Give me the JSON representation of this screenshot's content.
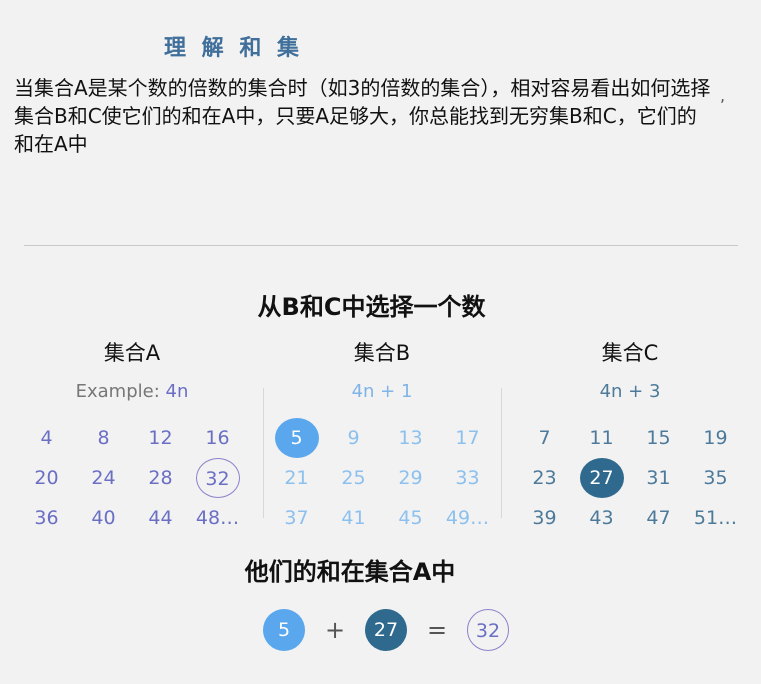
{
  "title": "理 解 和 集",
  "intro": "当集合A是某个数的倍数的集合时（如3的倍数的集合），相对容易看出如何选择集合B和C使它们的和在A中，只要A足够大，你总能找到无穷集B和C，它们的和在A中",
  "stray_mark": ",",
  "choose_heading": "从B和C中选择一个数",
  "sets": {
    "a": {
      "name": "集合A",
      "example_label": "Example:",
      "formula": "4n",
      "numbers": [
        "4",
        "8",
        "12",
        "16",
        "20",
        "24",
        "28",
        "32",
        "36",
        "40",
        "44",
        "48…"
      ]
    },
    "b": {
      "name": "集合B",
      "formula": "4n + 1",
      "numbers": [
        "5",
        "9",
        "13",
        "17",
        "21",
        "25",
        "29",
        "33",
        "37",
        "41",
        "45",
        "49…"
      ]
    },
    "c": {
      "name": "集合C",
      "formula": "4n + 3",
      "numbers": [
        "7",
        "11",
        "15",
        "19",
        "23",
        "27",
        "31",
        "35",
        "39",
        "43",
        "47",
        "51…"
      ]
    }
  },
  "sum_heading": "他们的和在集合A中",
  "equation": {
    "b": "5",
    "plus": "+",
    "c": "27",
    "equals": "=",
    "a": "32"
  },
  "colors": {
    "title": "#3f6f9a",
    "set_a": "#6a6fc4",
    "set_b": "#8cc0ee",
    "set_c": "#4d7a9a",
    "selected_b": "#5aa7ee",
    "selected_c": "#2f6a8e",
    "ring": "#8c82cc"
  }
}
